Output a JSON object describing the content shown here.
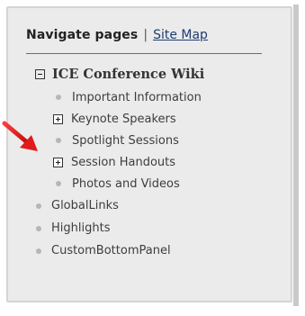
{
  "nav": {
    "title": "Navigate pages",
    "separator": "|",
    "site_map_link": "Site Map"
  },
  "tree": {
    "root": {
      "label": "ICE Conference Wiki",
      "state": "expanded",
      "icon": "minus-box-icon"
    },
    "children": [
      {
        "label": "Important Information",
        "type": "leaf",
        "icon": "bullet-icon"
      },
      {
        "label": "Keynote Speakers",
        "type": "collapsed",
        "icon": "plus-box-icon"
      },
      {
        "label": "Spotlight Sessions",
        "type": "leaf",
        "icon": "bullet-icon"
      },
      {
        "label": "Session Handouts",
        "type": "collapsed",
        "icon": "plus-box-icon"
      },
      {
        "label": "Photos and Videos",
        "type": "leaf",
        "icon": "bullet-icon"
      }
    ],
    "top_level": [
      {
        "label": "GlobalLinks",
        "icon": "bullet-icon"
      },
      {
        "label": "Highlights",
        "icon": "bullet-icon"
      },
      {
        "label": "CustomBottomPanel",
        "icon": "bullet-icon"
      }
    ]
  },
  "annotation": {
    "icon": "red-arrow-icon",
    "color": "#e01b1b",
    "points_to": "Session Handouts"
  },
  "colors": {
    "panel_background": "#ebebeb",
    "panel_border": "#d4d4d4",
    "link": "#1f3b73",
    "text": "#3d3d3d",
    "bullet": "#b6b6b6"
  }
}
